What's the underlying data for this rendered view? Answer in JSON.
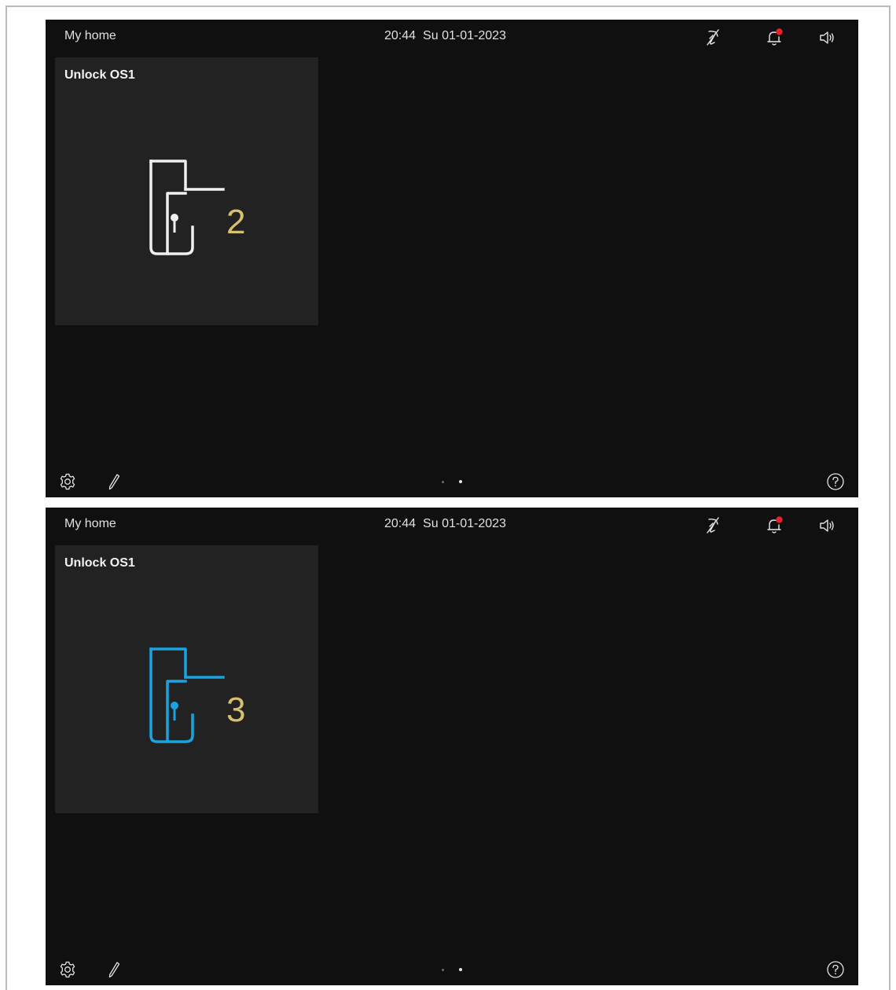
{
  "screens": [
    {
      "status": {
        "home_title": "My home",
        "time": "20:44",
        "date": "Su 01-01-2023",
        "icons": [
          "phone-muted-icon",
          "bell-notification-icon",
          "speaker-icon"
        ],
        "notification_dot_color": "#e8202a"
      },
      "tile": {
        "title": "Unlock OS1",
        "count": "2",
        "icon": "door-handle-lock-icon",
        "icon_color": "#f0f0f0",
        "count_color": "#d9c06d"
      },
      "bottom": {
        "icons": [
          "settings-gear-icon",
          "edit-pencil-icon",
          "help-icon"
        ],
        "pages": 2,
        "current_page": 2
      }
    },
    {
      "status": {
        "home_title": "My home",
        "time": "20:44",
        "date": "Su 01-01-2023",
        "icons": [
          "phone-muted-icon",
          "bell-notification-icon",
          "speaker-icon"
        ],
        "notification_dot_color": "#e8202a"
      },
      "tile": {
        "title": "Unlock OS1",
        "count": "3",
        "icon": "door-handle-lock-icon",
        "icon_color": "#1aa3e0",
        "count_color": "#d9c06d"
      },
      "bottom": {
        "icons": [
          "settings-gear-icon",
          "edit-pencil-icon",
          "help-icon"
        ],
        "pages": 2,
        "current_page": 2
      }
    }
  ]
}
